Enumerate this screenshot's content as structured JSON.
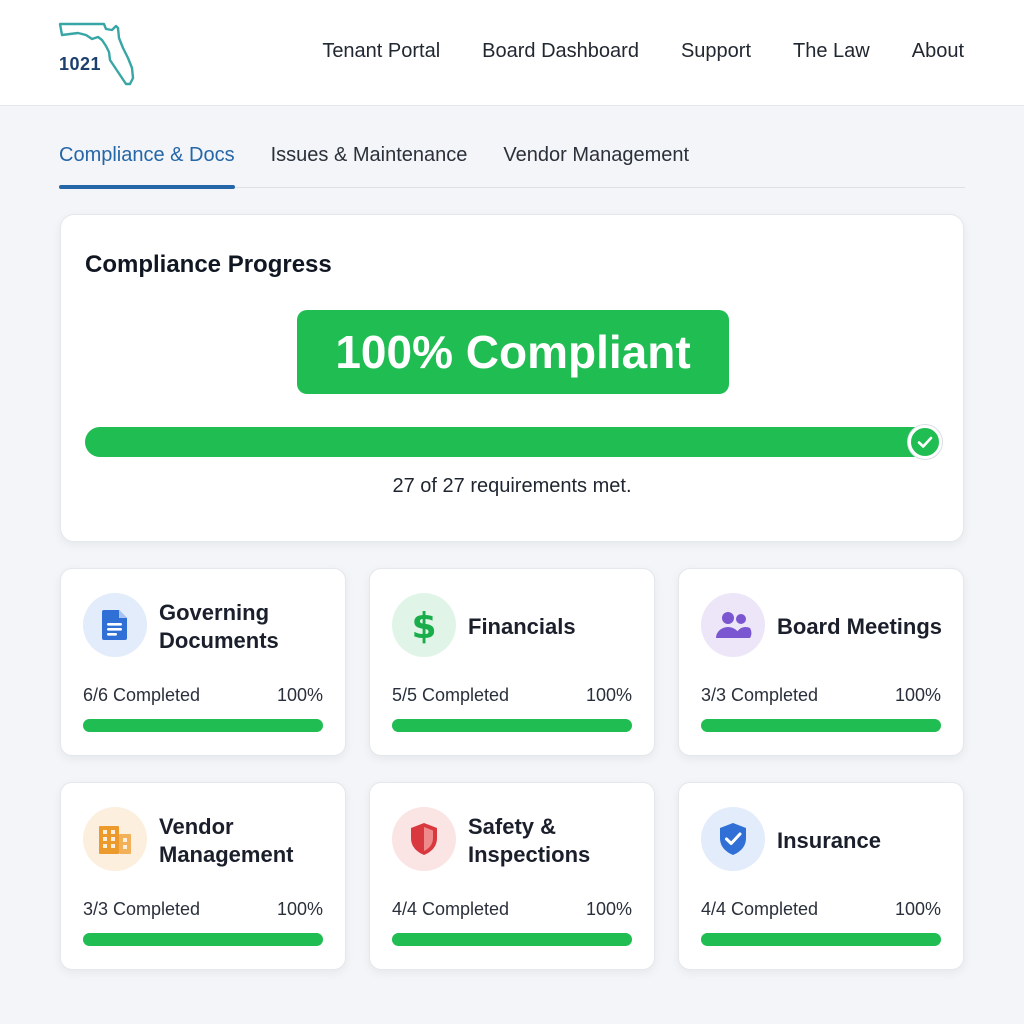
{
  "logo": {
    "text": "1021",
    "icon": "florida-map-icon"
  },
  "nav": {
    "items": [
      "Tenant Portal",
      "Board Dashboard",
      "Support",
      "The Law",
      "About"
    ]
  },
  "tabs": [
    {
      "label": "Compliance & Docs",
      "active": true
    },
    {
      "label": "Issues & Maintenance",
      "active": false
    },
    {
      "label": "Vendor Management",
      "active": false
    }
  ],
  "progress": {
    "title": "Compliance Progress",
    "badge": "100% Compliant",
    "fraction": 1.0,
    "caption": "27 of 27 requirements met.",
    "icon": "checkmark-icon"
  },
  "categories": [
    {
      "title": "Governing Documents",
      "status": "6/6 Completed",
      "percent": "100%",
      "fraction": 1.0,
      "icon": "document-icon",
      "icon_color": "#2f6fd6",
      "icon_bg": "#e3ecfb"
    },
    {
      "title": "Financials",
      "status": "5/5 Completed",
      "percent": "100%",
      "fraction": 1.0,
      "icon": "dollar-icon",
      "icon_color": "#19ad4b",
      "icon_bg": "#e0f5e7"
    },
    {
      "title": "Board Meetings",
      "status": "3/3 Completed",
      "percent": "100%",
      "fraction": 1.0,
      "icon": "people-icon",
      "icon_color": "#7a56d0",
      "icon_bg": "#ede6f9"
    },
    {
      "title": "Vendor Management",
      "status": "3/3 Completed",
      "percent": "100%",
      "fraction": 1.0,
      "icon": "building-icon",
      "icon_color": "#ec9a2c",
      "icon_bg": "#fcefdd"
    },
    {
      "title": "Safety & Inspections",
      "status": "4/4 Completed",
      "percent": "100%",
      "fraction": 1.0,
      "icon": "shield-icon",
      "icon_color": "#d9393e",
      "icon_bg": "#fbe4e4"
    },
    {
      "title": "Insurance",
      "status": "4/4 Completed",
      "percent": "100%",
      "fraction": 1.0,
      "icon": "shield-check-icon",
      "icon_color": "#2f6fd6",
      "icon_bg": "#e3ecfb"
    }
  ],
  "colors": {
    "accent": "#2566a8",
    "success": "#1fbd52",
    "background": "#f3f5f8"
  }
}
